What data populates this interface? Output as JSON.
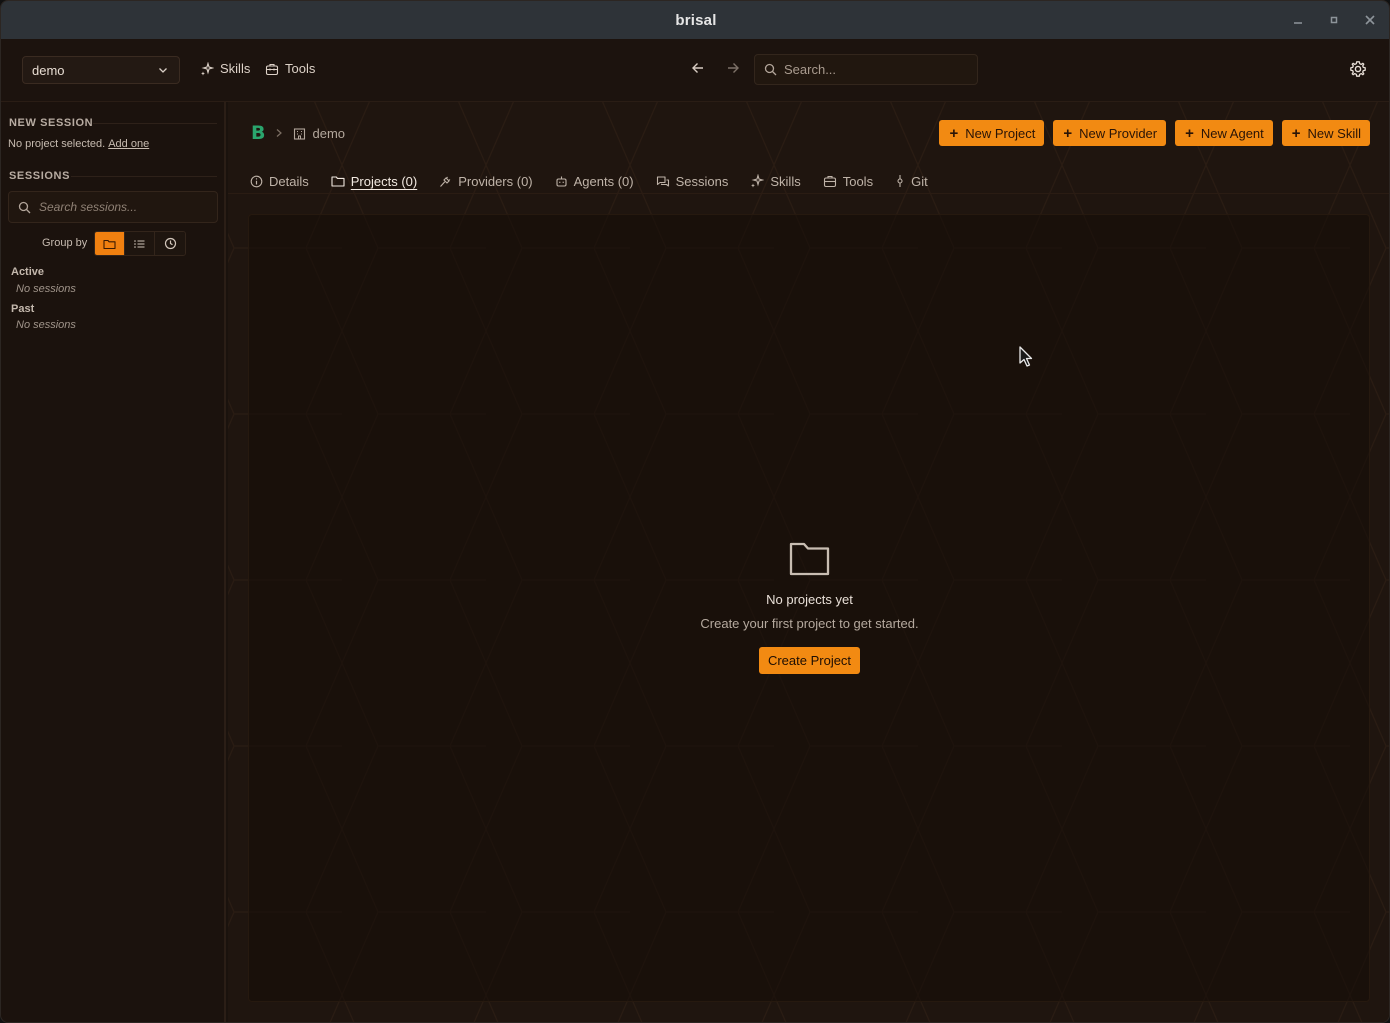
{
  "window": {
    "title": "brisal",
    "controls": {
      "minimize": "minimize-icon",
      "maximize": "maximize-icon",
      "close": "close-icon"
    }
  },
  "toolbar": {
    "workspace": "demo",
    "links": [
      {
        "label": "Skills",
        "icon": "sparkle-icon"
      },
      {
        "label": "Tools",
        "icon": "toolbox-icon"
      }
    ],
    "search_placeholder": "Search..."
  },
  "sidebar": {
    "new_session_heading": "NEW SESSION",
    "no_project_text": "No project selected.",
    "add_one_link": "Add one",
    "sessions_heading": "SESSIONS",
    "search_placeholder": "Search sessions...",
    "group_by_label": "Group by",
    "group_by_options": [
      "folder",
      "list",
      "time"
    ],
    "group_by_active": "folder",
    "groups": [
      {
        "title": "Active",
        "empty": "No sessions"
      },
      {
        "title": "Past",
        "empty": "No sessions"
      }
    ]
  },
  "main": {
    "breadcrumb": {
      "logo": "B",
      "workspace": "demo"
    },
    "actions": [
      "New Project",
      "New Provider",
      "New Agent",
      "New Skill"
    ],
    "tabs": [
      {
        "label": "Details",
        "icon": "info-icon"
      },
      {
        "label": "Projects (0)",
        "icon": "folder-icon",
        "active": true
      },
      {
        "label": "Providers (0)",
        "icon": "plug-icon"
      },
      {
        "label": "Agents (0)",
        "icon": "bot-icon"
      },
      {
        "label": "Sessions",
        "icon": "chat-icon"
      },
      {
        "label": "Skills",
        "icon": "sparkle-icon"
      },
      {
        "label": "Tools",
        "icon": "toolbox-icon"
      },
      {
        "label": "Git",
        "icon": "git-commit-icon"
      }
    ],
    "empty_state": {
      "title": "No projects yet",
      "subtitle": "Create your first project to get started.",
      "button": "Create Project"
    }
  },
  "colors": {
    "accent": "#f28a12",
    "background": "#1f150f",
    "sidebar": "#1b120d",
    "titlebar": "#2e3338",
    "logo": "#2aa56d"
  }
}
